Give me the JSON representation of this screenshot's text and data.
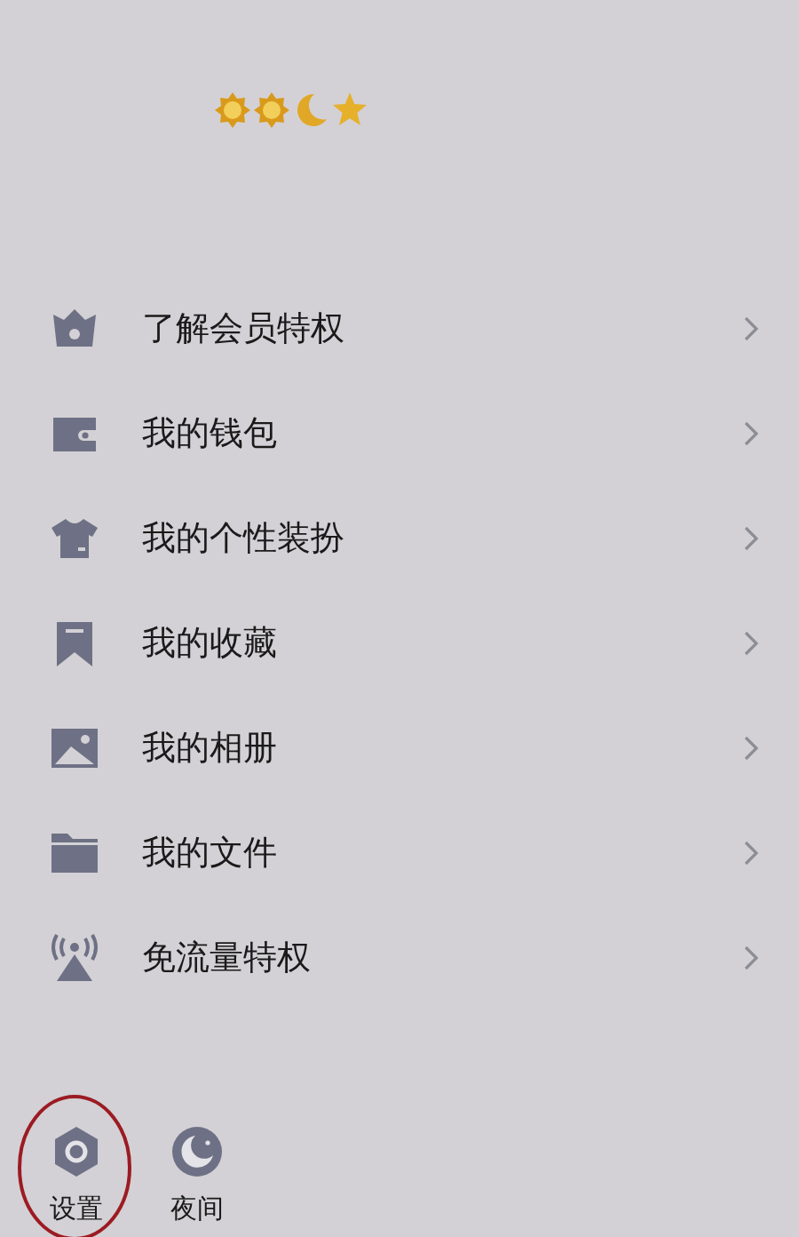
{
  "level_badges": [
    {
      "kind": "sun"
    },
    {
      "kind": "sun"
    },
    {
      "kind": "moon"
    },
    {
      "kind": "star"
    }
  ],
  "menu": [
    {
      "kind": "crown",
      "label": "了解会员特权"
    },
    {
      "kind": "wallet",
      "label": "我的钱包"
    },
    {
      "kind": "shirt",
      "label": "我的个性装扮"
    },
    {
      "kind": "bookmark",
      "label": "我的收藏"
    },
    {
      "kind": "photo",
      "label": "我的相册"
    },
    {
      "kind": "folder",
      "label": "我的文件"
    },
    {
      "kind": "antenna",
      "label": "免流量特权"
    }
  ],
  "bottom_bar": [
    {
      "kind": "settings",
      "label": "设置",
      "highlighted": true
    },
    {
      "kind": "night",
      "label": "夜间",
      "highlighted": false
    }
  ]
}
